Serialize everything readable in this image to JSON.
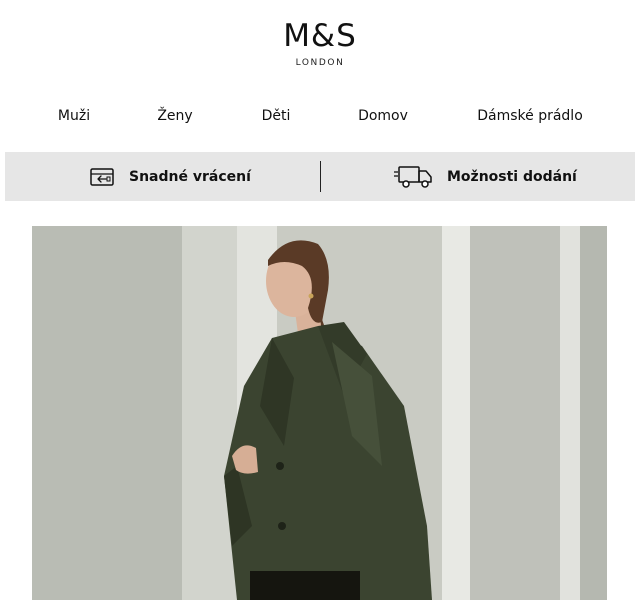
{
  "brand": {
    "name": "M&S",
    "sub": "LONDON"
  },
  "nav": {
    "items": [
      {
        "label": "Muži"
      },
      {
        "label": "Ženy"
      },
      {
        "label": "Děti"
      },
      {
        "label": "Domov"
      },
      {
        "label": "Dámské prádlo"
      }
    ]
  },
  "services": {
    "returns": {
      "label": "Snadné vrácení",
      "icon": "return-box-icon"
    },
    "delivery": {
      "label": "Možnosti dodání",
      "icon": "delivery-truck-icon"
    }
  },
  "hero": {
    "image": "woman-in-green-leather-jacket-photo",
    "colors": {
      "jacket": "#3b4430",
      "wall": "#c4c6bf",
      "hair": "#5a3a26"
    }
  }
}
